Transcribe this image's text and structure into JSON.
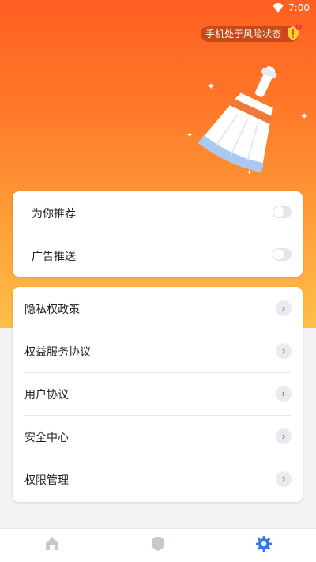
{
  "status_bar": {
    "time": "7:00",
    "icons": [
      "wifi-icon"
    ]
  },
  "risk_banner": {
    "text": "手机处于风险状态",
    "badge": "!",
    "icon": "shield-warning-icon"
  },
  "hero": {
    "illustration": "broom-icon",
    "colors": {
      "top": "#ff5f22",
      "bottom": "#ffbf48"
    }
  },
  "settings_toggles": [
    {
      "label": "为你推荐",
      "enabled": false
    },
    {
      "label": "广告推送",
      "enabled": false
    }
  ],
  "links": [
    {
      "label": "隐私权政策"
    },
    {
      "label": "权益服务协议"
    },
    {
      "label": "用户协议"
    },
    {
      "label": "安全中心"
    },
    {
      "label": "权限管理"
    }
  ],
  "chevron_glyph": "›",
  "bottom_nav": {
    "tabs": [
      {
        "icon": "home-icon",
        "active": false
      },
      {
        "icon": "shield-icon",
        "active": false
      },
      {
        "icon": "gear-icon",
        "active": true
      }
    ],
    "active_color": "#2e7bf0",
    "inactive_color": "#c6c8d0"
  }
}
